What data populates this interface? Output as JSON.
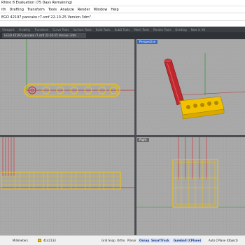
{
  "app": {
    "title": "Rhino 8 Evaluation (75 Days Remaining)"
  },
  "menu": [
    "ith",
    "Drafting",
    "Transform",
    "Tools",
    "Analyze",
    "Render",
    "Window",
    "Help"
  ],
  "command_line": {
    "text": "EGO 42197 pancake r7.smf 22-10-25 Version.3dm\""
  },
  "toolbar_tabs": [
    "Viewport",
    "Visibility",
    "Transform",
    "Curve Tools",
    "Surface Tools",
    "Solid Tools",
    "SubD Tools",
    "Mesh Tools",
    "Render Tools",
    "Drafting",
    "New in V8"
  ],
  "file_tab": {
    "label": "LEGO 42197 pancake r7.smf 22-10-25 Version.3dm"
  },
  "viewports": {
    "top_left": {
      "label": ""
    },
    "perspective": {
      "label": "Perspective"
    },
    "bottom_left": {
      "label": ""
    },
    "right": {
      "label": "Right"
    }
  },
  "status": {
    "units": "Millimeters",
    "layer": "4142133",
    "grid_snap": "Grid Snap",
    "ortho": "Ortho",
    "planar": "Planar",
    "osnap": "Osnap",
    "smarttrack": "SmartTrack",
    "gumball": "Gumball (CPlane)",
    "auto_cplane": "Auto CPlane (Object)"
  },
  "colors": {
    "viewport_bg": "#a9a9a9",
    "model_outline": "#f2c200",
    "selected_pin": "#d0343a",
    "active_label": "#3a6bbf"
  }
}
